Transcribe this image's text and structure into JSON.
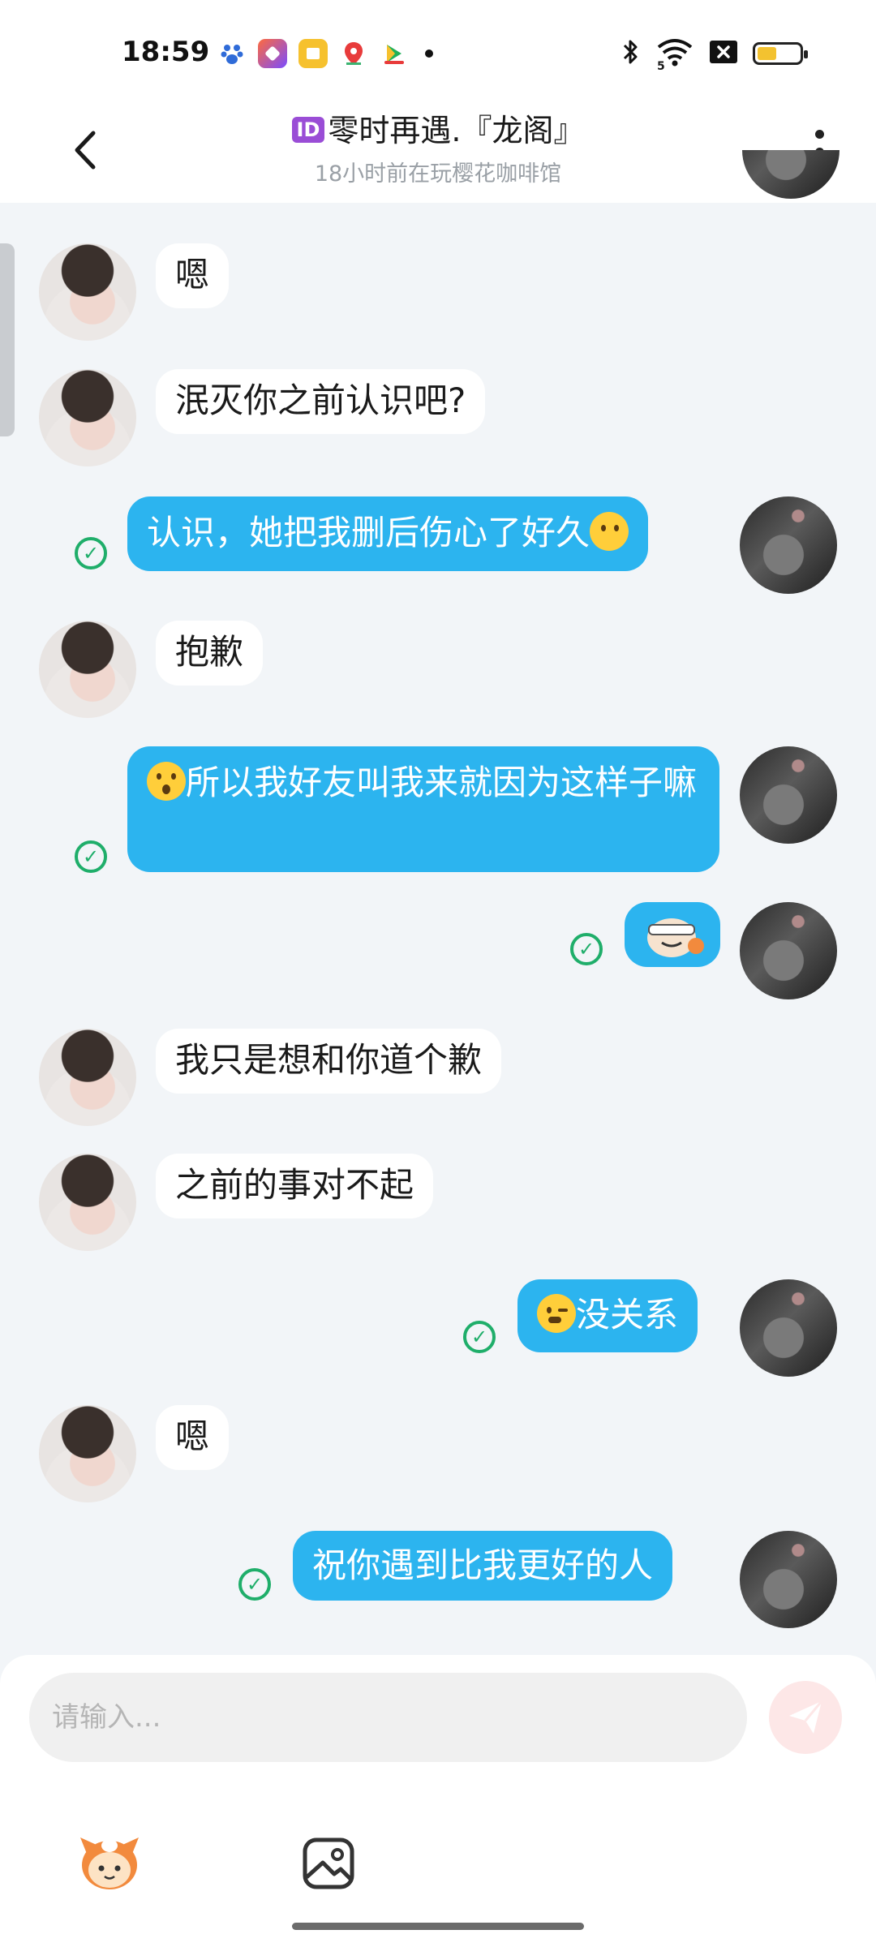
{
  "status_bar": {
    "time": "18:59",
    "app_icons": [
      "paw-app-icon",
      "app-icon-2",
      "app-icon-3",
      "map-pin-app-icon",
      "video-app-icon"
    ],
    "icons": [
      "bluetooth-icon",
      "wifi-icon",
      "sim-off-icon",
      "battery-icon"
    ],
    "wifi_label": "5",
    "battery_level": 0.45
  },
  "header": {
    "badge": "ID",
    "title": "零时再遇.『龙阁』",
    "subtitle": "18小时前在玩樱花咖啡馆"
  },
  "messages": [
    {
      "side": "in",
      "text": "嗯"
    },
    {
      "side": "in",
      "text": "泯灭你之前认识吧?"
    },
    {
      "side": "out",
      "text": "认识，她把我删后伤心了好久",
      "emoji_after": "emoji-neutral"
    },
    {
      "side": "in",
      "text": "抱歉"
    },
    {
      "side": "out",
      "text": "所以我好友叫我来就因为这样子嘛",
      "emoji_before": "emoji-surprised"
    },
    {
      "side": "out",
      "sticker": "bandaged-face-sticker"
    },
    {
      "side": "in",
      "text": "我只是想和你道个歉"
    },
    {
      "side": "in",
      "text": "之前的事对不起"
    },
    {
      "side": "out",
      "text": "没关系",
      "emoji_before": "emoji-wink"
    },
    {
      "side": "in",
      "text": "嗯"
    },
    {
      "side": "out",
      "text": "祝你遇到比我更好的人"
    }
  ],
  "input": {
    "placeholder": "请输入...",
    "value": ""
  },
  "toolbar": {
    "emoji_icon": "mascot-emoji-icon",
    "image_icon": "image-icon",
    "send_icon": "send-icon"
  },
  "colors": {
    "outgoing_bubble": "#2cb4ef",
    "incoming_bubble": "#ffffff",
    "background": "#f2f5f8",
    "read_check": "#1fae6a",
    "send_button": "#fde7e7"
  }
}
